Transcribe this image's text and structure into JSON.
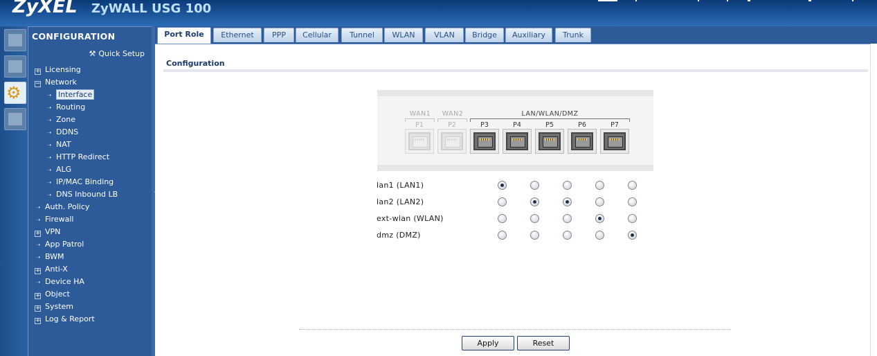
{
  "header": {
    "brand": "ZyXEL",
    "product": "ZyWALL USG 100"
  },
  "sidebar": {
    "title": "CONFIGURATION",
    "quick_setup": "Quick Setup",
    "items": [
      {
        "label": "Licensing",
        "marker": "+",
        "level": 0
      },
      {
        "label": "Network",
        "marker": "-",
        "level": 0
      },
      {
        "label": "Interface",
        "marker": "arrow",
        "level": 1,
        "selected": true
      },
      {
        "label": "Routing",
        "marker": "arrow",
        "level": 1
      },
      {
        "label": "Zone",
        "marker": "arrow",
        "level": 1
      },
      {
        "label": "DDNS",
        "marker": "arrow",
        "level": 1
      },
      {
        "label": "NAT",
        "marker": "arrow",
        "level": 1
      },
      {
        "label": "HTTP Redirect",
        "marker": "arrow",
        "level": 1
      },
      {
        "label": "ALG",
        "marker": "arrow",
        "level": 1
      },
      {
        "label": "IP/MAC Binding",
        "marker": "arrow",
        "level": 1
      },
      {
        "label": "DNS Inbound LB",
        "marker": "arrow",
        "level": 1
      },
      {
        "label": "Auth. Policy",
        "marker": "arrow",
        "level": 0
      },
      {
        "label": "Firewall",
        "marker": "arrow",
        "level": 0
      },
      {
        "label": "VPN",
        "marker": "+",
        "level": 0
      },
      {
        "label": "App Patrol",
        "marker": "arrow",
        "level": 0
      },
      {
        "label": "BWM",
        "marker": "arrow",
        "level": 0
      },
      {
        "label": "Anti-X",
        "marker": "+",
        "level": 0
      },
      {
        "label": "Device HA",
        "marker": "arrow",
        "level": 0
      },
      {
        "label": "Object",
        "marker": "+",
        "level": 0
      },
      {
        "label": "System",
        "marker": "+",
        "level": 0
      },
      {
        "label": "Log & Report",
        "marker": "+",
        "level": 0
      }
    ]
  },
  "tabs": [
    {
      "label": "Port Role",
      "active": true
    },
    {
      "label": "Ethernet"
    },
    {
      "label": "PPP"
    },
    {
      "label": "Cellular"
    },
    {
      "label": "Tunnel"
    },
    {
      "label": "WLAN"
    },
    {
      "label": "VLAN"
    },
    {
      "label": "Bridge"
    },
    {
      "label": "Auxiliary"
    },
    {
      "label": "Trunk"
    }
  ],
  "section": {
    "title": "Configuration"
  },
  "port_groups": {
    "wan1": "WAN1",
    "wan2": "WAN2",
    "lan": "LAN/WLAN/DMZ"
  },
  "ports": [
    "P1",
    "P2",
    "P3",
    "P4",
    "P5",
    "P6",
    "P7"
  ],
  "roles": [
    {
      "label": "lan1 (LAN1)",
      "selected": [
        true,
        false,
        false,
        false,
        false
      ]
    },
    {
      "label": "lan2 (LAN2)",
      "selected": [
        false,
        true,
        true,
        false,
        false
      ]
    },
    {
      "label": "ext-wlan (WLAN)",
      "selected": [
        false,
        false,
        false,
        true,
        false
      ]
    },
    {
      "label": "dmz (DMZ)",
      "selected": [
        false,
        false,
        false,
        false,
        true
      ]
    }
  ],
  "buttons": {
    "apply": "Apply",
    "reset": "Reset"
  },
  "colors": {
    "header": "#0b3a78",
    "sidebar": "#2d5a98",
    "accent": "#1a3a6b"
  }
}
